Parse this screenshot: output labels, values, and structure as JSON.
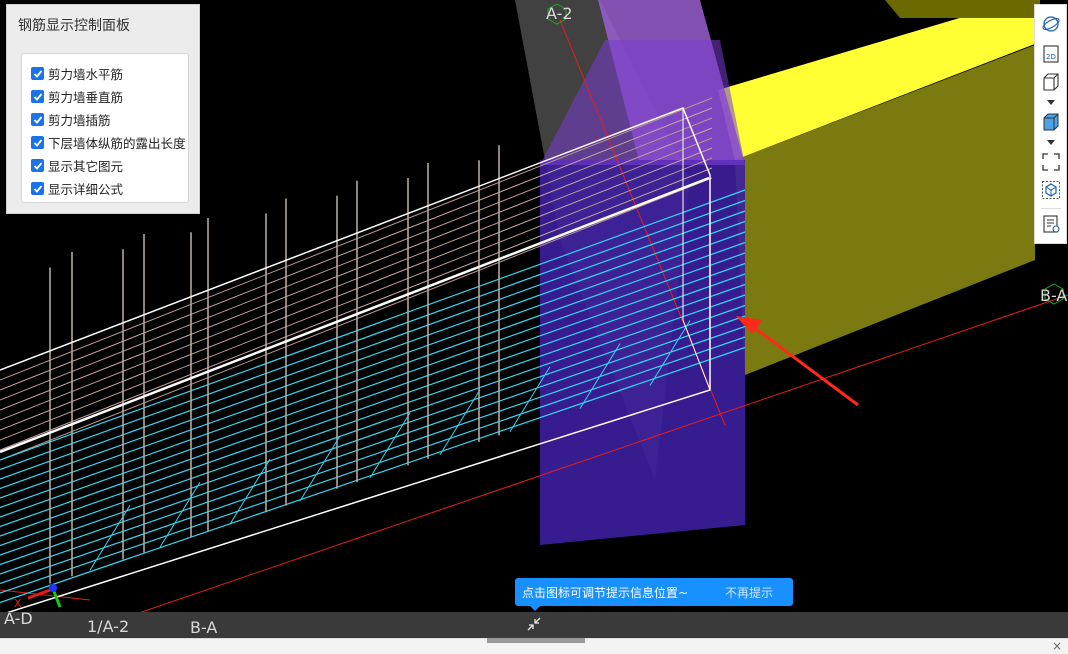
{
  "control_panel": {
    "title": "钢筋显示控制面板",
    "options": [
      {
        "label": "剪力墙水平筋",
        "checked": true
      },
      {
        "label": "剪力墙垂直筋",
        "checked": true
      },
      {
        "label": "剪力墙插筋",
        "checked": true
      },
      {
        "label": "下层墙体纵筋的露出长度",
        "checked": true
      },
      {
        "label": "显示其它图元",
        "checked": true
      },
      {
        "label": "显示详细公式",
        "checked": true
      }
    ]
  },
  "axis_labels": {
    "a2_top": "A-2",
    "ba_right": "B-A",
    "ad_bottom": "A-D",
    "a2_bottom": "1/A-2",
    "ba_bottom": "B-A"
  },
  "coordinate_axes": {
    "x": "X",
    "y": "Y"
  },
  "toolbar": {
    "icons": [
      "orbit-icon",
      "2d-view-icon",
      "cube-outline-icon",
      "cube-solid-icon",
      "fullscreen-icon",
      "3d-box-icon",
      "legend-view-icon"
    ]
  },
  "tooltip": {
    "text": "点击图标可调节提示信息位置~",
    "dismiss": "不再提示"
  },
  "colors": {
    "background": "#000000",
    "horizontal_rebar": "#33d6f0",
    "vertical_rebar": "#bfb0a8",
    "wall_fill": "#7a7a10",
    "wall_top": "#ffff33",
    "column_fill": "#3d1fa0",
    "axis_line": "#e0201c",
    "accent": "#1890ff",
    "checkbox": "#1a73e8"
  }
}
